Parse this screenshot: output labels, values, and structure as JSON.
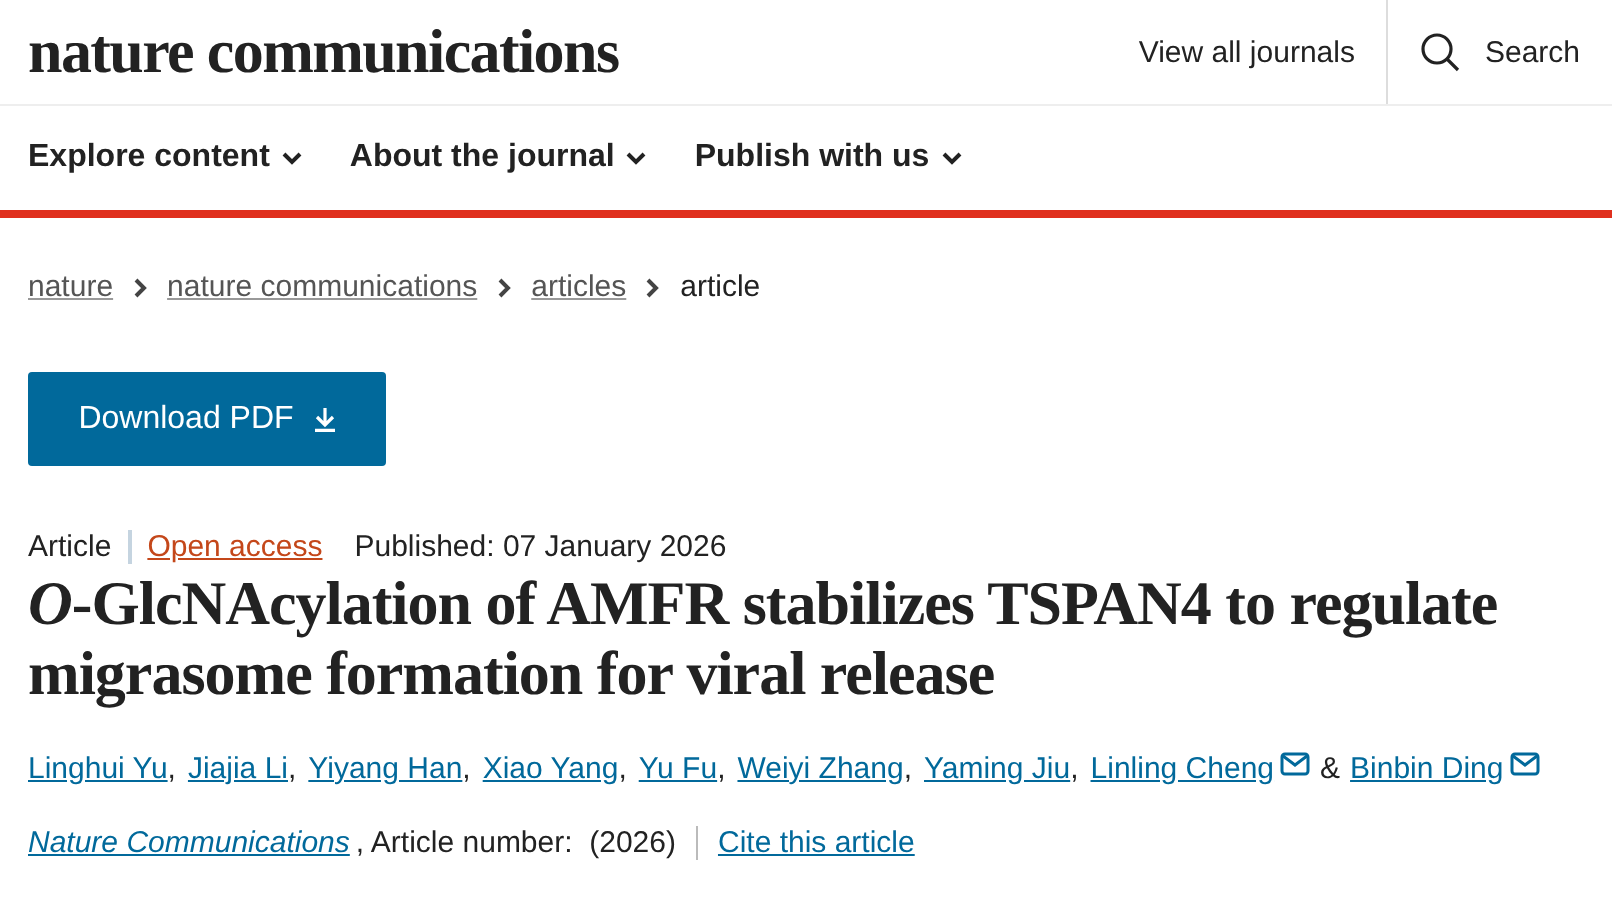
{
  "header": {
    "logo": "nature communications",
    "links": [
      {
        "label": "View all journals",
        "kind": "link"
      },
      {
        "label": "Search",
        "kind": "search"
      }
    ]
  },
  "nav": [
    {
      "label": "Explore content"
    },
    {
      "label": "About the journal"
    },
    {
      "label": "Publish with us"
    }
  ],
  "breadcrumb": [
    {
      "label": "nature",
      "current": false
    },
    {
      "label": "nature communications",
      "current": false
    },
    {
      "label": "articles",
      "current": false
    },
    {
      "label": "article",
      "current": true
    }
  ],
  "download_button": "Download PDF",
  "meta": {
    "type": "Article",
    "access": "Open access",
    "published": "Published: 07 January 2026"
  },
  "title": "*O*-GlcNAcylation of AMFR stabilizes TSPAN4 to regulate migrasome formation for viral release",
  "authors": [
    {
      "name": "Linghui Yu",
      "email": false,
      "after": ","
    },
    {
      "name": "Jiajia Li",
      "email": false,
      "after": ","
    },
    {
      "name": "Yiyang Han",
      "email": false,
      "after": ","
    },
    {
      "name": "Xiao Yang",
      "email": false,
      "after": ","
    },
    {
      "name": "Yu Fu",
      "email": false,
      "after": ","
    },
    {
      "name": "Weiyi Zhang",
      "email": false,
      "after": ","
    },
    {
      "name": "Yaming Jiu",
      "email": false,
      "after": ","
    },
    {
      "name": "Linling Cheng",
      "email": true,
      "after": "&"
    },
    {
      "name": "Binbin Ding",
      "email": true
    }
  ],
  "citation": {
    "journal": "Nature Communications",
    "details": ", Article number:  (2026)",
    "cite": "Cite this article"
  }
}
